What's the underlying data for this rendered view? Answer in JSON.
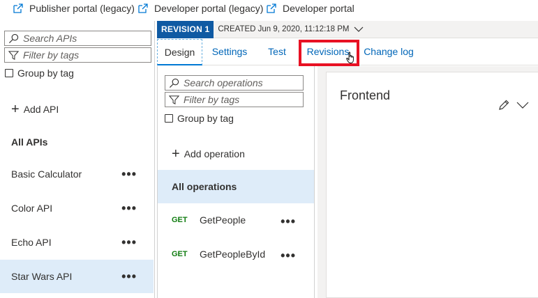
{
  "portal_links": [
    {
      "label": "Publisher portal (legacy)",
      "icon": "external-link-icon"
    },
    {
      "label": "Developer portal (legacy)",
      "icon": "external-link-icon"
    },
    {
      "label": "Developer portal",
      "icon": "external-link-icon"
    }
  ],
  "api_list": {
    "search_placeholder": "Search APIs",
    "filter_placeholder": "Filter by tags",
    "group_by_label": "Group by tag",
    "add_label": "Add API",
    "section_title": "All APIs",
    "items": [
      {
        "label": "Basic Calculator",
        "selected": false
      },
      {
        "label": "Color API",
        "selected": false
      },
      {
        "label": "Echo API",
        "selected": false
      },
      {
        "label": "Star Wars API",
        "selected": true
      }
    ],
    "more_label": "•••"
  },
  "revision": {
    "badge": "REVISION 1",
    "created": "CREATED Jun 9, 2020, 11:12:18 PM"
  },
  "tabs": [
    {
      "label": "Design",
      "active": true
    },
    {
      "label": "Settings",
      "active": false
    },
    {
      "label": "Test",
      "active": false
    },
    {
      "label": "Revisions",
      "active": false,
      "highlighted": true
    },
    {
      "label": "Change log",
      "active": false
    }
  ],
  "operations": {
    "search_placeholder": "Search operations",
    "filter_placeholder": "Filter by tags",
    "group_by_label": "Group by tag",
    "add_label": "Add operation",
    "all_label": "All operations",
    "items": [
      {
        "method": "GET",
        "name": "GetPeople"
      },
      {
        "method": "GET",
        "name": "GetPeopleById"
      }
    ],
    "more_label": "•••"
  },
  "editor": {
    "title": "Frontend"
  },
  "colors": {
    "accent": "#0078d4",
    "revision_badge": "#0f5aa3",
    "selected_bg": "#deecf9",
    "get_method": "#107c10",
    "highlight": "#e81123"
  }
}
